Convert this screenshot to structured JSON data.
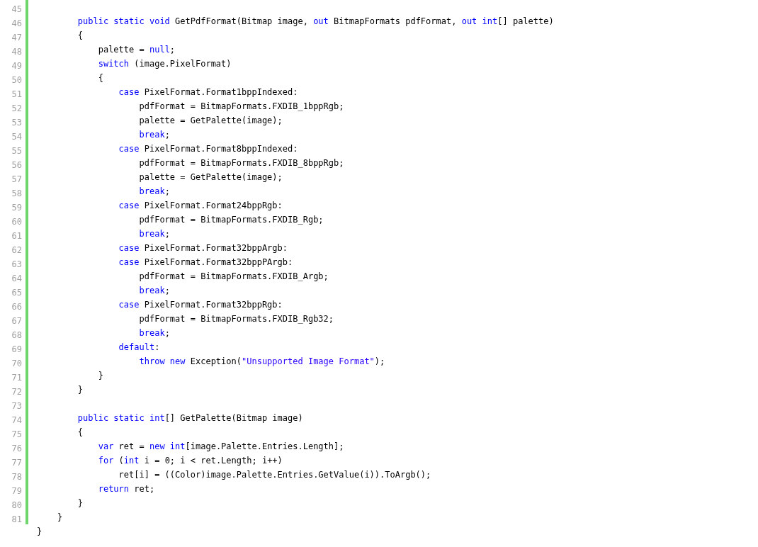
{
  "lines": [
    {
      "number": "45",
      "changed": true
    },
    {
      "number": "46",
      "changed": true,
      "tokens": [
        {
          "kind": "keyword",
          "text": "        public static void"
        },
        {
          "kind": "plain",
          "text": " GetPdfFormat(Bitmap image, "
        },
        {
          "kind": "keyword",
          "text": "out"
        },
        {
          "kind": "plain",
          "text": " BitmapFormats pdfFormat, "
        },
        {
          "kind": "keyword",
          "text": "out int"
        },
        {
          "kind": "plain",
          "text": "[] palette)"
        }
      ]
    },
    {
      "number": "47",
      "changed": true,
      "tokens": [
        {
          "kind": "plain",
          "text": "        {"
        }
      ]
    },
    {
      "number": "48",
      "changed": true,
      "tokens": [
        {
          "kind": "plain",
          "text": "            palette = "
        },
        {
          "kind": "keyword",
          "text": "null"
        },
        {
          "kind": "plain",
          "text": ";"
        }
      ]
    },
    {
      "number": "49",
      "changed": true,
      "tokens": [
        {
          "kind": "keyword",
          "text": "            switch"
        },
        {
          "kind": "plain",
          "text": " (image.PixelFormat)"
        }
      ]
    },
    {
      "number": "50",
      "changed": true,
      "tokens": [
        {
          "kind": "plain",
          "text": "            {"
        }
      ]
    },
    {
      "number": "51",
      "changed": true,
      "tokens": [
        {
          "kind": "keyword",
          "text": "                case"
        },
        {
          "kind": "plain",
          "text": " PixelFormat.Format1bppIndexed:"
        }
      ]
    },
    {
      "number": "52",
      "changed": true,
      "tokens": [
        {
          "kind": "plain",
          "text": "                    pdfFormat = BitmapFormats.FXDIB_1bppRgb;"
        }
      ]
    },
    {
      "number": "53",
      "changed": true,
      "tokens": [
        {
          "kind": "plain",
          "text": "                    palette = GetPalette(image);"
        }
      ]
    },
    {
      "number": "54",
      "changed": true,
      "tokens": [
        {
          "kind": "keyword",
          "text": "                    break"
        },
        {
          "kind": "plain",
          "text": ";"
        }
      ]
    },
    {
      "number": "55",
      "changed": true,
      "tokens": [
        {
          "kind": "keyword",
          "text": "                case"
        },
        {
          "kind": "plain",
          "text": " PixelFormat.Format8bppIndexed:"
        }
      ]
    },
    {
      "number": "56",
      "changed": true,
      "tokens": [
        {
          "kind": "plain",
          "text": "                    pdfFormat = BitmapFormats.FXDIB_8bppRgb;"
        }
      ]
    },
    {
      "number": "57",
      "changed": true,
      "tokens": [
        {
          "kind": "plain",
          "text": "                    palette = GetPalette(image);"
        }
      ]
    },
    {
      "number": "58",
      "changed": true,
      "tokens": [
        {
          "kind": "keyword",
          "text": "                    break"
        },
        {
          "kind": "plain",
          "text": ";"
        }
      ]
    },
    {
      "number": "59",
      "changed": true,
      "tokens": [
        {
          "kind": "keyword",
          "text": "                case"
        },
        {
          "kind": "plain",
          "text": " PixelFormat.Format24bppRgb:"
        }
      ]
    },
    {
      "number": "60",
      "changed": true,
      "tokens": [
        {
          "kind": "plain",
          "text": "                    pdfFormat = BitmapFormats.FXDIB_Rgb;"
        }
      ]
    },
    {
      "number": "61",
      "changed": true,
      "tokens": [
        {
          "kind": "keyword",
          "text": "                    break"
        },
        {
          "kind": "plain",
          "text": ";"
        }
      ]
    },
    {
      "number": "62",
      "changed": true,
      "tokens": [
        {
          "kind": "keyword",
          "text": "                case"
        },
        {
          "kind": "plain",
          "text": " PixelFormat.Format32bppArgb:"
        }
      ]
    },
    {
      "number": "63",
      "changed": true,
      "tokens": [
        {
          "kind": "keyword",
          "text": "                case"
        },
        {
          "kind": "plain",
          "text": " PixelFormat.Format32bppPArgb:"
        }
      ]
    },
    {
      "number": "64",
      "changed": true,
      "tokens": [
        {
          "kind": "plain",
          "text": "                    pdfFormat = BitmapFormats.FXDIB_Argb;"
        }
      ]
    },
    {
      "number": "65",
      "changed": true,
      "tokens": [
        {
          "kind": "keyword",
          "text": "                    break"
        },
        {
          "kind": "plain",
          "text": ";"
        }
      ]
    },
    {
      "number": "66",
      "changed": true,
      "tokens": [
        {
          "kind": "keyword",
          "text": "                case"
        },
        {
          "kind": "plain",
          "text": " PixelFormat.Format32bppRgb:"
        }
      ]
    },
    {
      "number": "67",
      "changed": true,
      "tokens": [
        {
          "kind": "plain",
          "text": "                    pdfFormat = BitmapFormats.FXDIB_Rgb32;"
        }
      ]
    },
    {
      "number": "68",
      "changed": true,
      "tokens": [
        {
          "kind": "keyword",
          "text": "                    break"
        },
        {
          "kind": "plain",
          "text": ";"
        }
      ]
    },
    {
      "number": "69",
      "changed": true,
      "tokens": [
        {
          "kind": "keyword",
          "text": "                default"
        },
        {
          "kind": "plain",
          "text": ":"
        }
      ]
    },
    {
      "number": "70",
      "changed": true,
      "tokens": [
        {
          "kind": "keyword",
          "text": "                    throw new"
        },
        {
          "kind": "plain",
          "text": " Exception("
        },
        {
          "kind": "string",
          "text": "\"Unsupported Image Format\""
        },
        {
          "kind": "plain",
          "text": ");"
        }
      ]
    },
    {
      "number": "71",
      "changed": true,
      "tokens": [
        {
          "kind": "plain",
          "text": "            }"
        }
      ]
    },
    {
      "number": "72",
      "changed": true,
      "tokens": [
        {
          "kind": "plain",
          "text": "        }"
        }
      ]
    },
    {
      "number": "73",
      "changed": true
    },
    {
      "number": "74",
      "changed": true,
      "tokens": [
        {
          "kind": "keyword",
          "text": "        public static int"
        },
        {
          "kind": "plain",
          "text": "[] GetPalette(Bitmap image)"
        }
      ]
    },
    {
      "number": "75",
      "changed": true,
      "tokens": [
        {
          "kind": "plain",
          "text": "        {"
        }
      ]
    },
    {
      "number": "76",
      "changed": true,
      "tokens": [
        {
          "kind": "keyword",
          "text": "            var"
        },
        {
          "kind": "plain",
          "text": " ret = "
        },
        {
          "kind": "keyword",
          "text": "new int"
        },
        {
          "kind": "plain",
          "text": "[image.Palette.Entries.Length];"
        }
      ]
    },
    {
      "number": "77",
      "changed": true,
      "tokens": [
        {
          "kind": "keyword",
          "text": "            for"
        },
        {
          "kind": "plain",
          "text": " ("
        },
        {
          "kind": "keyword",
          "text": "int"
        },
        {
          "kind": "plain",
          "text": " i = 0; i < ret.Length; i++)"
        }
      ]
    },
    {
      "number": "78",
      "changed": true,
      "tokens": [
        {
          "kind": "plain",
          "text": "                ret[i] = ((Color)image.Palette.Entries.GetValue(i)).ToArgb();"
        }
      ]
    },
    {
      "number": "79",
      "changed": true,
      "tokens": [
        {
          "kind": "keyword",
          "text": "            return"
        },
        {
          "kind": "plain",
          "text": " ret;"
        }
      ]
    },
    {
      "number": "80",
      "changed": true,
      "tokens": [
        {
          "kind": "plain",
          "text": "        }"
        }
      ]
    },
    {
      "number": "81",
      "changed": true,
      "tokens": [
        {
          "kind": "plain",
          "text": "    }"
        }
      ]
    },
    {
      "changed": false,
      "tokens": [
        {
          "kind": "plain",
          "text": "}"
        }
      ]
    }
  ]
}
